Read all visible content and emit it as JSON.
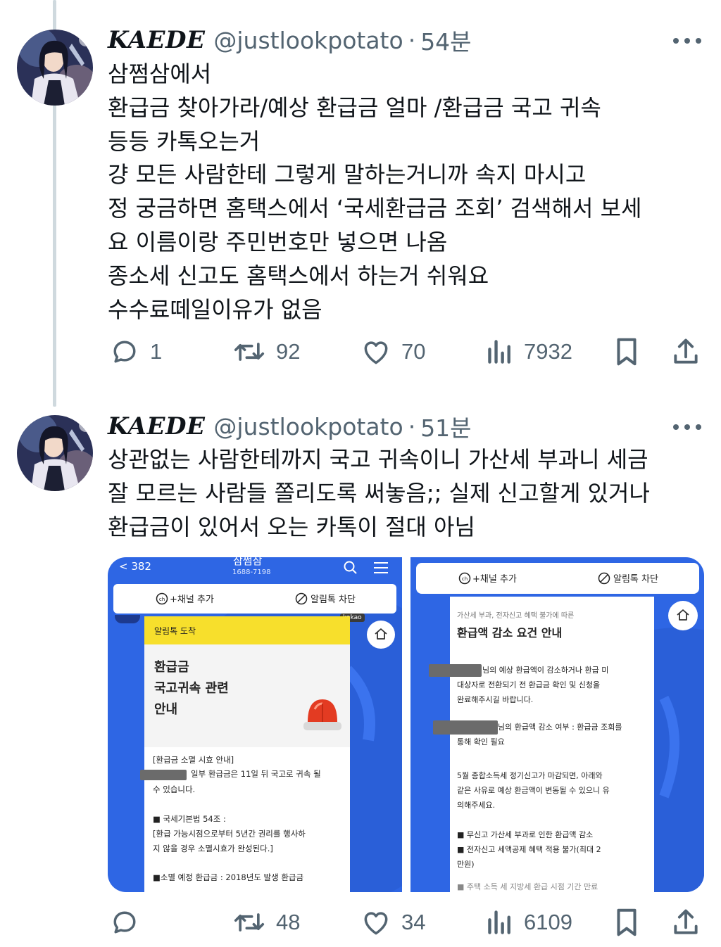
{
  "tweets": [
    {
      "display_name": "KAEDE",
      "handle": "@justlookpotato",
      "separator": "·",
      "time": "54분",
      "lines": [
        "삼쩜삼에서",
        "환급금 찾아가라/예상 환급금 얼마 /환급금 국고 귀속",
        "등등 카톡오는거",
        "걍 모든 사람한테 그렇게 말하는거니까 속지 마시고",
        "정 궁금하면 홈택스에서 ‘국세환급금 조회’ 검색해서 보세",
        "요 이름이랑 주민번호만 넣으면 나옴",
        "종소세 신고도 홈택스에서 하는거 쉬워요",
        "수수료떼일이유가 없음"
      ],
      "stats": {
        "replies": "1",
        "retweets": "92",
        "likes": "70",
        "views": "7932"
      }
    },
    {
      "display_name": "KAEDE",
      "handle": "@justlookpotato",
      "separator": "·",
      "time": "51분",
      "lines": [
        "상관없는 사람한테까지 국고 귀속이니 가산세 부과니 세금",
        "잘 모르는 사람들 쫄리도록 써놓음;; 실제 신고할게 있거나",
        "환급금이 있어서 오는 카톡이 절대 아님"
      ],
      "stats": {
        "replies": "",
        "retweets": "48",
        "likes": "34",
        "views": "6109"
      }
    }
  ],
  "screenshot_left": {
    "back": "< 382",
    "app_title": "삼쩜삼",
    "phone": "1688-7198",
    "add_channel": "+채널 추가",
    "block": "알림톡 차단",
    "kakao_badge": "kakao",
    "banner": "알림톡 도착",
    "heading_lines": [
      "환급금",
      "국고귀속 관련",
      "안내"
    ],
    "notice_title": "[환급금 소멸 시효 안내]",
    "notice_line1": "일부 환급금은 11일 뒤 국고로 귀속 될",
    "notice_line2": "수 있습니다.",
    "law_title": "■ 국세기본법 54조 :",
    "law_line1": "[환급 가능시점으로부터 5년간 권리를 행사하",
    "law_line2": "지 않을 경우 소멸시효가 완성된다.]",
    "expire_line": "■소멸 예정 환급금 : 2018년도 발생 환급금"
  },
  "screenshot_right": {
    "add_channel": "+채널 추가",
    "block": "알림톡 차단",
    "subtitle": "가산세 부과, 전자신고 혜택 불가에 따른",
    "title": "환급액 감소 요건 안내",
    "p1_line1": "님의 예상 환급액이 감소하거나 환급 미",
    "p1_line2": "대상자로 전환되기 전 환급금 확인 및 신청을",
    "p1_line3": "완료해주시길 바랍니다.",
    "p2_line1": "님의 환급액 감소 여부 : 환급금 조회를",
    "p2_line2": "통해 확인 필요",
    "p3_line1": "5월 종합소득세 정기신고가 마감되면, 아래와",
    "p3_line2": "같은 사유로 예상 환급액이 변동될 수 있으니 유",
    "p3_line3": "의해주세요.",
    "b1": "■ 무신고 가산세 부과로 인한 환급액 감소",
    "b2_line1": "■ 전자신고 세액공제 혜택 적용 불가(최대 2",
    "b2_line2": "만원)",
    "b3": "■ 주택 소득 세 지방세 환급 시점 기간 만료"
  },
  "icons": [
    "reply-icon",
    "retweet-icon",
    "like-icon",
    "views-icon",
    "bookmark-icon",
    "share-icon",
    "more-icon",
    "search-icon",
    "menu-icon",
    "home-icon",
    "block-icon",
    "channel-icon",
    "siren-icon"
  ],
  "colors": {
    "text": "#0f1419",
    "secondary": "#536471",
    "thread_line": "#cfd9de",
    "kakao_blue": "#2e66e4",
    "banner_yellow": "#f7df2c",
    "siren_red": "#e33b22"
  }
}
